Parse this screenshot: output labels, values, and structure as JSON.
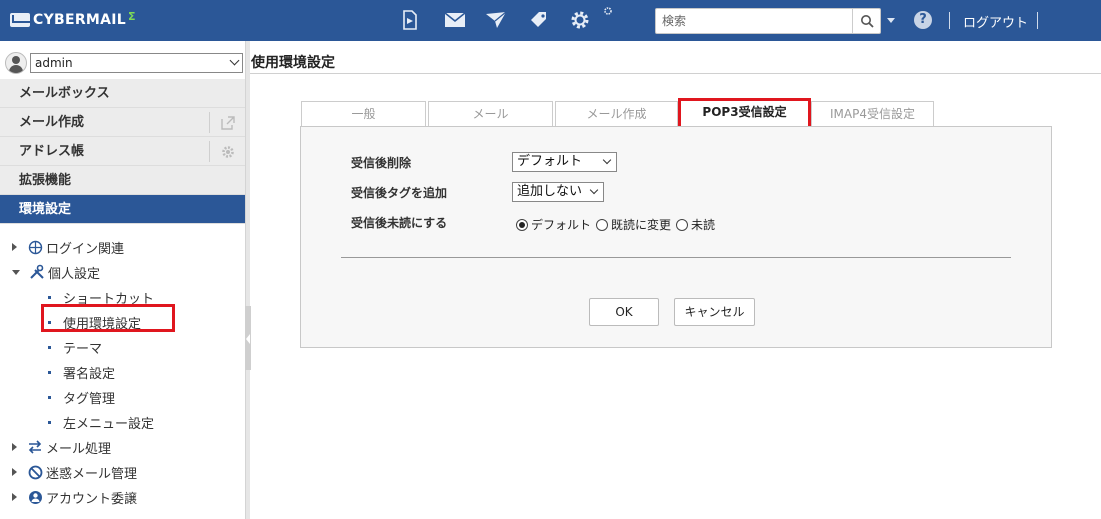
{
  "app": {
    "logo_text": "CYBERMAIL",
    "logo_mark": "Σ"
  },
  "topbar": {
    "search_placeholder": "検索",
    "logout_label": "ログアウト",
    "icons": [
      "document-share-icon",
      "mail-icon",
      "plane-icon",
      "tag-icon",
      "gear-icon"
    ]
  },
  "user": {
    "name": "admin"
  },
  "mainnav": {
    "items": [
      {
        "label": "メールボックス"
      },
      {
        "label": "メール作成"
      },
      {
        "label": "アドレス帳"
      },
      {
        "label": "拡張機能"
      },
      {
        "label": "環境設定"
      }
    ]
  },
  "tree": {
    "login": "ログイン関連",
    "personal": "個人設定",
    "children": [
      "ショートカット",
      "使用環境設定",
      "テーマ",
      "署名設定",
      "タグ管理",
      "左メニュー設定"
    ],
    "mailproc": "メール処理",
    "spam": "迷惑メール管理",
    "account": "アカウント委譲"
  },
  "page": {
    "title": "使用環境設定"
  },
  "tabs": [
    "一般",
    "メール",
    "メール作成",
    "POP3受信設定",
    "IMAP4受信設定"
  ],
  "form": {
    "delete_label": "受信後削除",
    "delete_value": "デフォルト",
    "tag_label": "受信後タグを追加",
    "tag_value": "追加しない",
    "unread_label": "受信後未読にする",
    "radio_options": [
      "デフォルト",
      "既読に変更",
      "未読"
    ],
    "radio_selected": "デフォルト",
    "ok_label": "OK",
    "cancel_label": "キャンセル"
  },
  "colors": {
    "topbar": "#2b5797",
    "highlight": "#e0161e"
  }
}
